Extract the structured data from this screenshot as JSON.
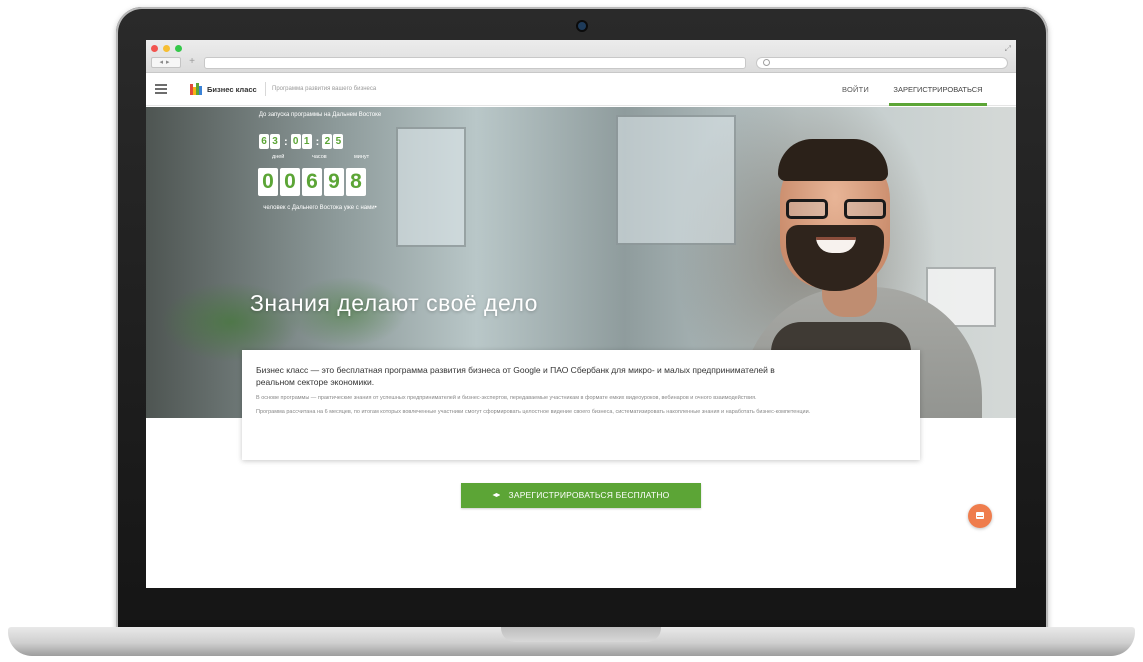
{
  "header": {
    "brand": "Бизнес класс",
    "tagline": "Программа развития вашего бизнеса",
    "login": "ВОЙТИ",
    "register": "ЗАРЕГИСТРИРОВАТЬСЯ"
  },
  "countdown": {
    "label": "До запуска программы на Дальнем Востоке",
    "days": [
      "6",
      "3"
    ],
    "hours": [
      "0",
      "1"
    ],
    "minutes": [
      "2",
      "5"
    ],
    "units": [
      "дней",
      "часов",
      "минут"
    ]
  },
  "counter": {
    "digits": [
      "0",
      "0",
      "6",
      "9",
      "8"
    ],
    "label": "человек с Дальнего Востока уже с нами•"
  },
  "hero": {
    "headline": "Знания делают своё дело"
  },
  "info": {
    "lead": "Бизнес класс — это бесплатная программа развития бизнеса от Google и ПАО Сбербанк для микро- и малых предпринимателей в реальном секторе экономики.",
    "paragraph1": "В основе программы — практические знания от успешных предпринимателей и бизнес-экспертов, передаваемые участникам в формате емких видеоуроков, вебинаров и очного взаимодействия.",
    "paragraph2": "Программа рассчитана на 6 месяцев, по итогам которых вовлеченные участники смогут сформировать целостное видение своего бизнеса, систематизировать накопленные знания и наработать бизнес-компетенции."
  },
  "cta": {
    "label": "ЗАРЕГИСТРИРОВАТЬСЯ БЕСПЛАТНО"
  },
  "colors": {
    "accent": "#5ca536",
    "fab": "#ef7d4d"
  },
  "icons": {
    "menu": "hamburger-icon",
    "logo": "bar-chart-logo-icon",
    "cta": "graduation-cap-icon",
    "fab": "mail-icon"
  }
}
